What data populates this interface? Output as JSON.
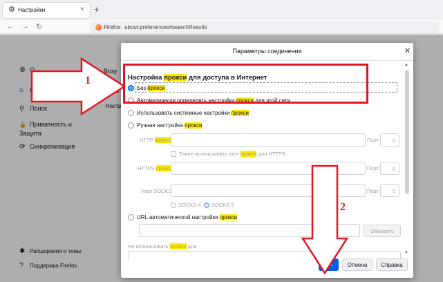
{
  "tabbar": {
    "tab_title": "Настройки",
    "tab_icon": "gear-icon",
    "close_glyph": "×",
    "newtab_glyph": "+",
    "window": {
      "minimize": "—",
      "maximize": "☐",
      "close": "✕"
    }
  },
  "navbar": {
    "back": "←",
    "forward": "→",
    "reload": "↻",
    "identity_label": "Firefox",
    "url": "about:preferences#searchResults"
  },
  "sidebar": {
    "items": [
      {
        "icon": "gear-icon",
        "glyph": "⚙",
        "label": "О"
      },
      {
        "icon": "home-icon",
        "glyph": "⌂",
        "label": "Н"
      },
      {
        "icon": "search-icon",
        "glyph": "⚲",
        "label": "Поиск"
      },
      {
        "icon": "lock-icon",
        "glyph": "🔒",
        "label": "Приватность и\nЗащита"
      },
      {
        "icon": "sync-icon",
        "glyph": "⟳",
        "label": "Синхронизация"
      }
    ],
    "bottom": [
      {
        "icon": "puzzle-icon",
        "glyph": "✱",
        "label": "Расширения и темы"
      },
      {
        "icon": "help-icon",
        "glyph": "?",
        "label": "Поддержка Firefox"
      }
    ]
  },
  "page_fragments": [
    "Возу",
    "Пара",
    "Настр"
  ],
  "dialog": {
    "title": "Параметры соединения",
    "close_glyph": "✕",
    "heading_pre": "Настройка ",
    "heading_hl": "прокси",
    "heading_post": " для доступа в Интернет",
    "options": {
      "none": {
        "pre": "Без ",
        "hl": "прокси",
        "post": ""
      },
      "auto": {
        "pre": "Автоматически определять настройки ",
        "hl": "прокси",
        "post": " для этой сети"
      },
      "system": {
        "pre": "Использовать системные настройки ",
        "hl": "прокси",
        "post": ""
      },
      "manual": {
        "pre": "Ручная настройка ",
        "hl": "прокси",
        "post": ""
      },
      "pac": {
        "pre": "URL автоматической настройки ",
        "hl": "прокси",
        "post": ""
      }
    },
    "http": {
      "pre": "HTTP ",
      "hl": "прокси",
      "port_label": "Порт",
      "port": "0"
    },
    "also_https": {
      "pre": "Также использовать этот ",
      "hl": "прокси",
      "post": " для HTTPS"
    },
    "https": {
      "pre": "HTTPS ",
      "hl": "прокси",
      "port_label": "Порт",
      "port": "0"
    },
    "socks": {
      "label": "Узел SOCKS",
      "port_label": "Порт",
      "port": "0"
    },
    "socks4": "SOCKS 4",
    "socks5": "SOCKS 5",
    "reload_button": "Обновить",
    "no_proxy": {
      "pre": "Не использовать ",
      "hl": "прокси",
      "post": " для"
    },
    "buttons": {
      "ok": "OK",
      "cancel": "Отмена",
      "help": "Справка"
    }
  },
  "annotations": {
    "one": "1",
    "two": "2",
    "color": "#e5141c"
  },
  "colors": {
    "accent": "#0061e0",
    "highlight": "#ffeb00"
  }
}
